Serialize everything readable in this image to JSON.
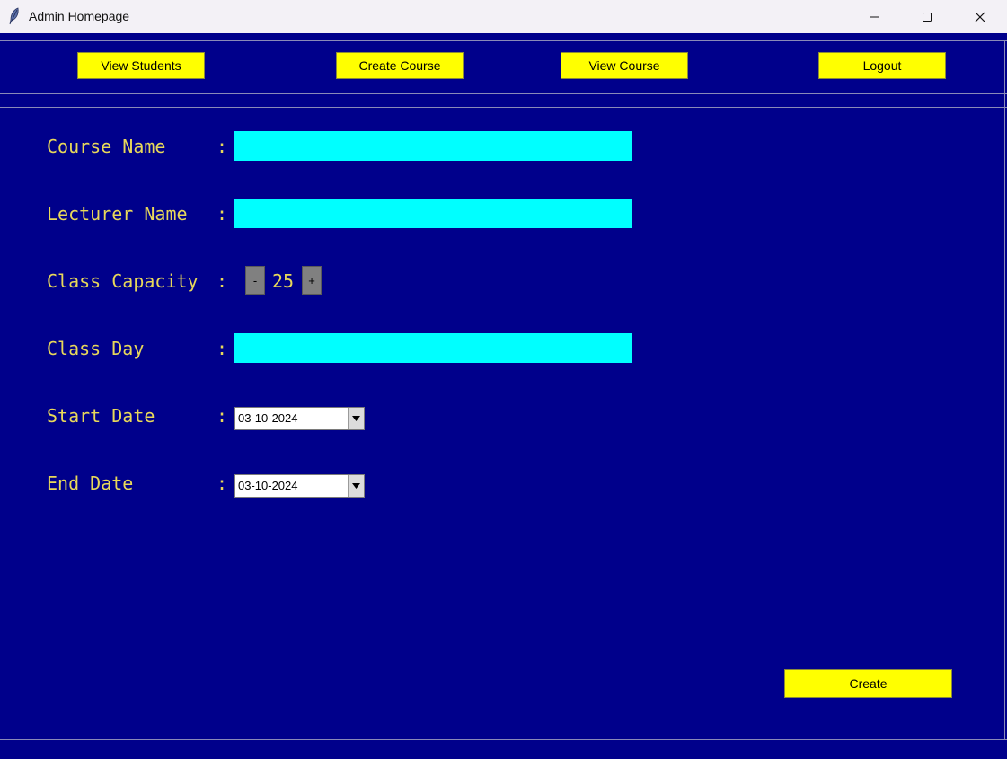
{
  "window": {
    "title": "Admin Homepage",
    "icon": "feather-icon",
    "controls": [
      "minimize-icon",
      "maximize-icon",
      "close-icon"
    ]
  },
  "nav": {
    "view_students": "View Students",
    "create_course": "Create Course",
    "view_course": "View Course",
    "logout": "Logout"
  },
  "form": {
    "course_name": {
      "label": "Course Name",
      "colon": ":",
      "value": ""
    },
    "lecturer_name": {
      "label": "Lecturer Name",
      "colon": ":",
      "value": ""
    },
    "class_capacity": {
      "label": "Class Capacity",
      "colon": ":",
      "minus": "-",
      "value": "25",
      "plus": "+"
    },
    "class_day": {
      "label": "Class Day",
      "colon": ":",
      "value": ""
    },
    "start_date": {
      "label": "Start Date",
      "colon": ":",
      "value": "03-10-2024"
    },
    "end_date": {
      "label": "End Date",
      "colon": ":",
      "value": "03-10-2024"
    }
  },
  "actions": {
    "create": "Create"
  },
  "colors": {
    "background": "#00008b",
    "button": "#ffff00",
    "input": "#00ffff",
    "label": "#e8d85a"
  }
}
